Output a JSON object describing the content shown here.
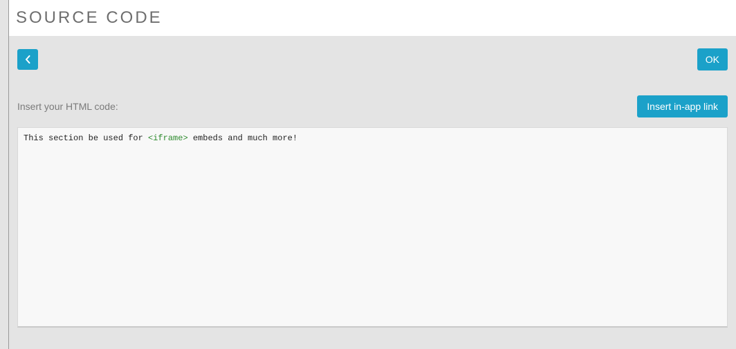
{
  "header": {
    "title": "SOURCE CODE"
  },
  "toolbar": {
    "ok_label": "OK"
  },
  "insert": {
    "label": "Insert your HTML code:",
    "link_button_label": "Insert in-app link"
  },
  "editor": {
    "text_before": "This section be used for ",
    "tag_text": "<iframe>",
    "text_after": " embeds and much more!"
  }
}
